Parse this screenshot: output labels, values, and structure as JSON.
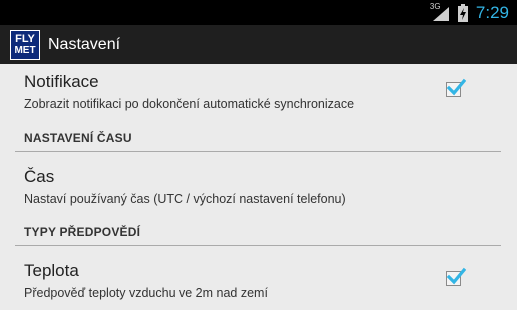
{
  "status_bar": {
    "network_type": "3G",
    "time": "7:29"
  },
  "action_bar": {
    "logo_top": "FLY",
    "logo_bottom": "MET",
    "title": "Nastavení"
  },
  "preferences": [
    {
      "title": "Notifikace",
      "summary": "Zobrazit notifikaci po dokončení automatické synchronizace",
      "checked": true
    },
    {
      "category": "NASTAVENÍ ČASU"
    },
    {
      "title": "Čas",
      "summary": "Nastaví používaný čas (UTC / výchozí nastavení telefonu)"
    },
    {
      "category": "TYPY PŘEDPOVĚDÍ"
    },
    {
      "title": "Teplota",
      "summary": "Předpověď teploty vzduchu ve 2m nad zemí",
      "checked": true
    }
  ],
  "colors": {
    "accent": "#33b5e5",
    "background": "#ebebeb",
    "action_bar": "#1f1f1f"
  }
}
